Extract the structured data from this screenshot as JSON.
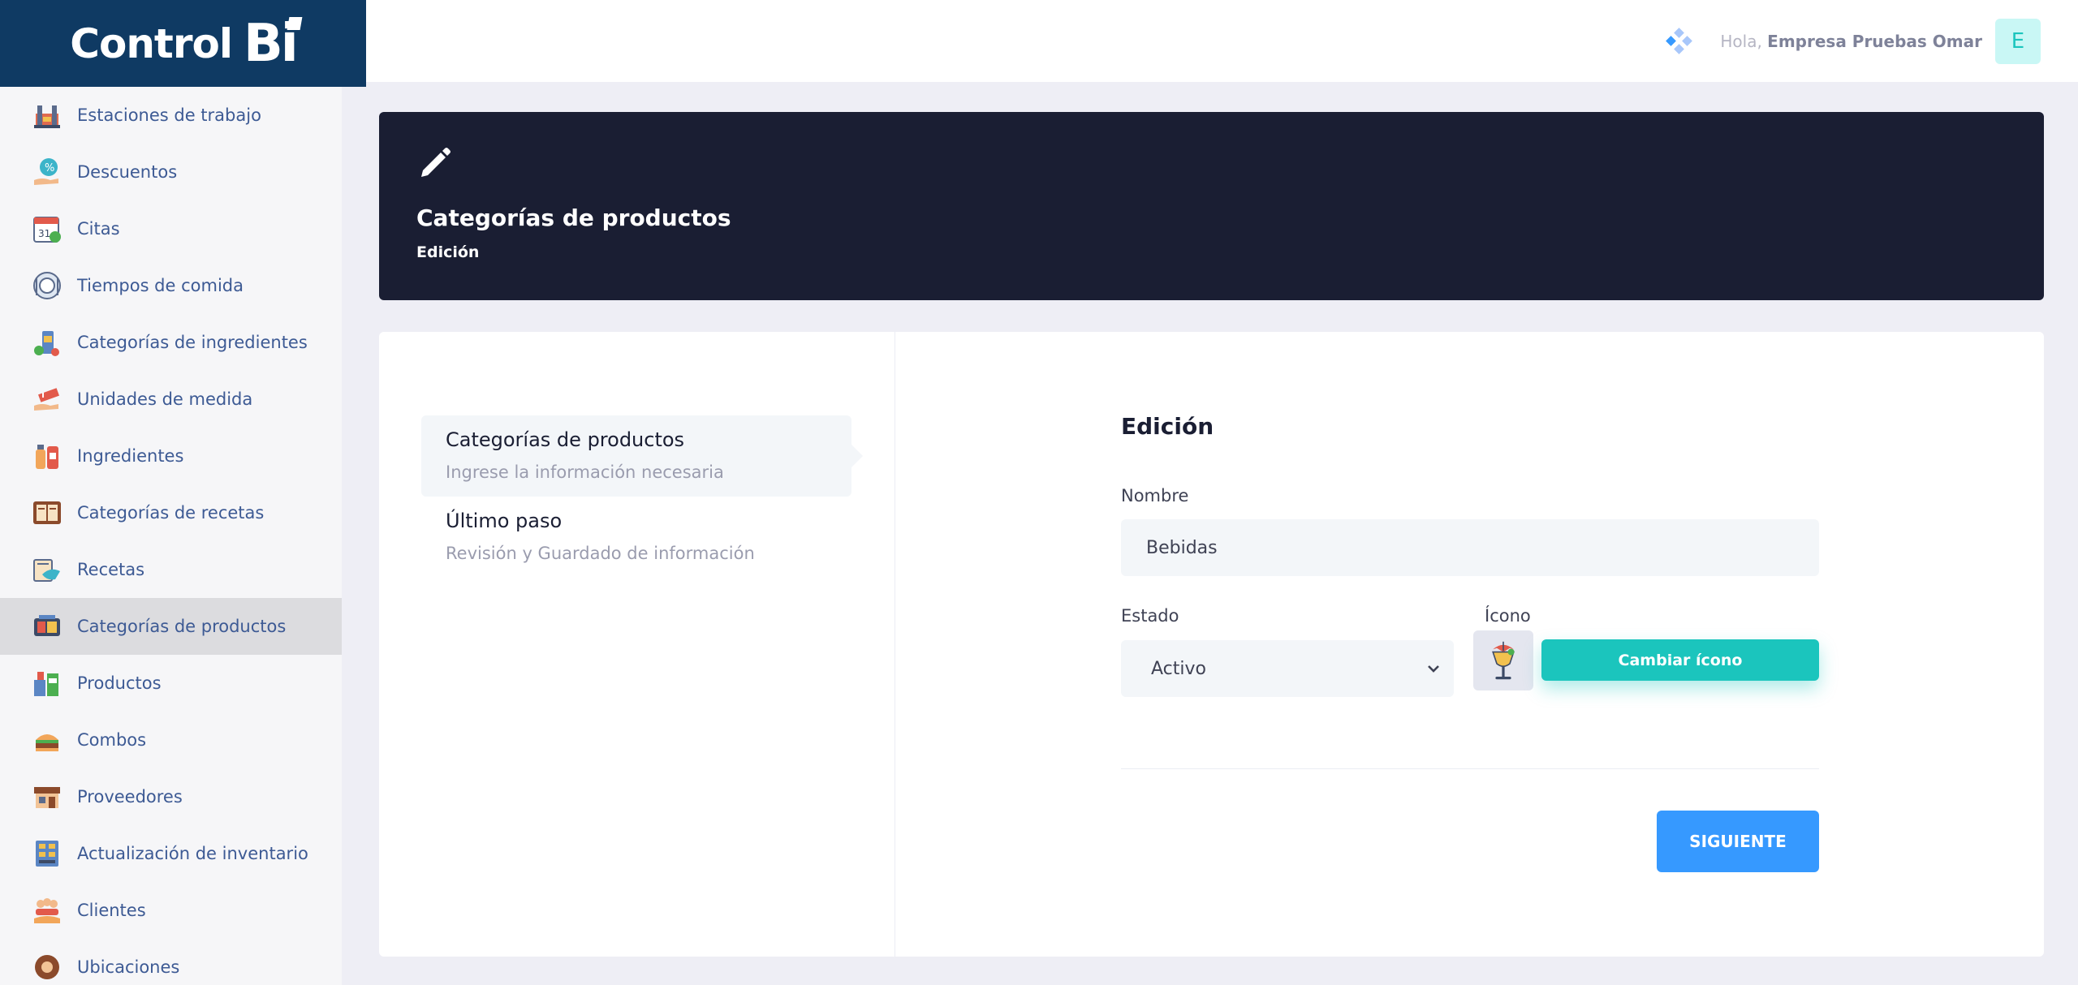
{
  "brand": {
    "name": "Control",
    "suffix": "Bi"
  },
  "sidebar": {
    "items": [
      {
        "label": "Estaciones de trabajo",
        "icon": "workstation-icon"
      },
      {
        "label": "Descuentos",
        "icon": "discount-icon"
      },
      {
        "label": "Citas",
        "icon": "calendar-icon"
      },
      {
        "label": "Tiempos de comida",
        "icon": "meal-time-icon"
      },
      {
        "label": "Categorías de ingredientes",
        "icon": "ingredient-category-icon"
      },
      {
        "label": "Unidades de medida",
        "icon": "measure-icon"
      },
      {
        "label": "Ingredientes",
        "icon": "ingredients-icon"
      },
      {
        "label": "Categorías de recetas",
        "icon": "recipe-category-icon"
      },
      {
        "label": "Recetas",
        "icon": "recipes-icon"
      },
      {
        "label": "Categorías de productos",
        "icon": "product-category-icon",
        "active": true
      },
      {
        "label": "Productos",
        "icon": "products-icon"
      },
      {
        "label": "Combos",
        "icon": "combos-icon"
      },
      {
        "label": "Proveedores",
        "icon": "suppliers-icon"
      },
      {
        "label": "Actualización de inventario",
        "icon": "inventory-icon"
      },
      {
        "label": "Clientes",
        "icon": "clients-icon"
      },
      {
        "label": "Ubicaciones",
        "icon": "locations-icon"
      }
    ]
  },
  "topbar": {
    "greeting": "Hola,",
    "user_name": "Empresa Pruebas Omar",
    "avatar_letter": "E"
  },
  "hero": {
    "title": "Categorías de productos",
    "subtitle": "Edición",
    "icon": "pencil-icon"
  },
  "wizard": {
    "steps": [
      {
        "title": "Categorías de productos",
        "desc": "Ingrese la información necesaria",
        "active": true
      },
      {
        "title": "Último paso",
        "desc": "Revisión y Guardado de información",
        "active": false
      }
    ]
  },
  "form": {
    "title": "Edición",
    "name_label": "Nombre",
    "name_value": "Bebidas",
    "status_label": "Estado",
    "status_value": "Activo",
    "icon_label": "Ícono",
    "icon_preview": "cocktail-icon",
    "change_icon_label": "Cambiar ícono",
    "next_label": "SIGUIENTE"
  },
  "colors": {
    "brand": "#0f3a63",
    "hero_bg": "#1a1e33",
    "teal": "#1bc5bd",
    "primary": "#3699ff",
    "sidebar_text": "#3d5a94"
  }
}
